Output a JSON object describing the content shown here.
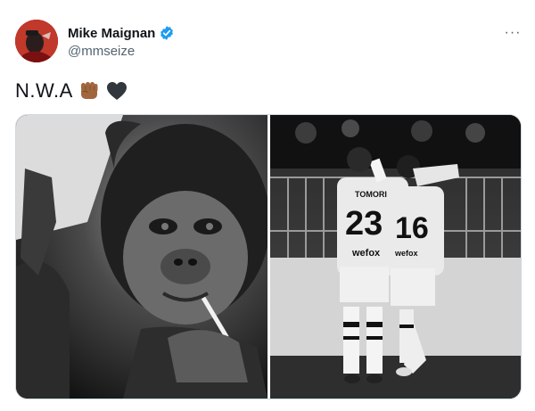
{
  "author": {
    "display_name": "Mike Maignan",
    "handle": "@mmseize",
    "verified": true,
    "verified_icon": "verified-badge-icon",
    "accent_color": "#1d9bf0"
  },
  "tweet": {
    "text": "N.W.A",
    "emojis": [
      "raised-fist-medium-dark-skin-icon",
      "black-heart-icon"
    ]
  },
  "media": {
    "left": {
      "description_icon": "chimpanzee-photo"
    },
    "right": {
      "description_icon": "players-photo",
      "players": [
        {
          "name": "TOMORI",
          "number": "23",
          "sponsor": "wefox"
        },
        {
          "number": "16",
          "sponsor": "wefox"
        }
      ]
    }
  },
  "menu": {
    "icon": "more-options-icon",
    "glyph": "···"
  }
}
